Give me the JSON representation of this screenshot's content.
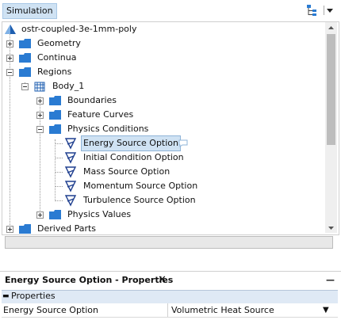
{
  "header": {
    "title": "Simulation"
  },
  "tree": {
    "root": "ostr-coupled-3e-1mm-poly",
    "items": [
      {
        "label": "Geometry"
      },
      {
        "label": "Continua"
      },
      {
        "label": "Regions"
      },
      {
        "label": "Body_1"
      },
      {
        "label": "Boundaries"
      },
      {
        "label": "Feature Curves"
      },
      {
        "label": "Physics Conditions"
      },
      {
        "label": "Energy Source Option"
      },
      {
        "label": "Initial Condition Option"
      },
      {
        "label": "Mass Source Option"
      },
      {
        "label": "Momentum Source Option"
      },
      {
        "label": "Turbulence Source Option"
      },
      {
        "label": "Physics Values"
      },
      {
        "label": "Derived Parts"
      }
    ]
  },
  "properties": {
    "tab_title": "Energy Source Option - Properties",
    "close_glyph": "✕",
    "minimize_glyph": "—",
    "section": "Properties",
    "section_toggle": "▬",
    "rows": [
      {
        "name": "Energy Source Option",
        "value": "Volumetric Heat Source"
      }
    ],
    "dropdown_glyph": "▼"
  },
  "colors": {
    "selection": "#cfe2f3",
    "folder": "#2a7bd2",
    "section_bg": "#dfe9f5"
  }
}
